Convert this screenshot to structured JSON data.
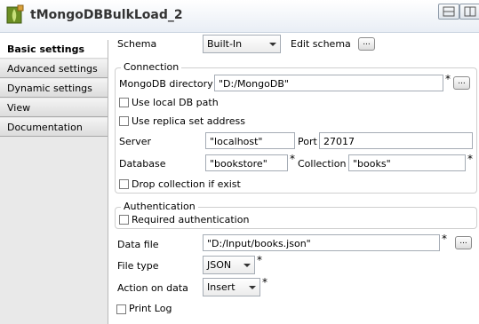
{
  "header": {
    "title": "tMongoDBBulkLoad_2",
    "icon": "mongodb-component-icon",
    "buttons": [
      "layout-toggle-icon",
      "layout-toggle-icon"
    ]
  },
  "sidebar": {
    "items": [
      {
        "label": "Basic settings",
        "active": true
      },
      {
        "label": "Advanced settings"
      },
      {
        "label": "Dynamic settings"
      },
      {
        "label": "View"
      },
      {
        "label": "Documentation"
      }
    ]
  },
  "schema": {
    "label": "Schema",
    "value": "Built-In",
    "edit_label": "Edit schema",
    "edit_button": "..."
  },
  "connection": {
    "title": "Connection",
    "mongodb_dir_label": "MongoDB directory",
    "mongodb_dir_value": "\"D:/MongoDB\"",
    "use_local_db_label": "Use local DB path",
    "use_replica_label": "Use replica set address",
    "server_label": "Server",
    "server_value": "\"localhost\"",
    "port_label": "Port",
    "port_value": "27017",
    "database_label": "Database",
    "database_value": "\"bookstore\"",
    "collection_label": "Collection",
    "collection_value": "\"books\"",
    "drop_collection_label": "Drop collection if exist"
  },
  "authentication": {
    "title": "Authentication",
    "required_label": "Required authentication"
  },
  "data_file": {
    "label": "Data file",
    "value": "\"D:/Input/books.json\""
  },
  "file_type": {
    "label": "File type",
    "value": "JSON"
  },
  "action": {
    "label": "Action on data",
    "value": "Insert"
  },
  "print_log_label": "Print Log",
  "required_mark": "*",
  "dots_label": "..."
}
